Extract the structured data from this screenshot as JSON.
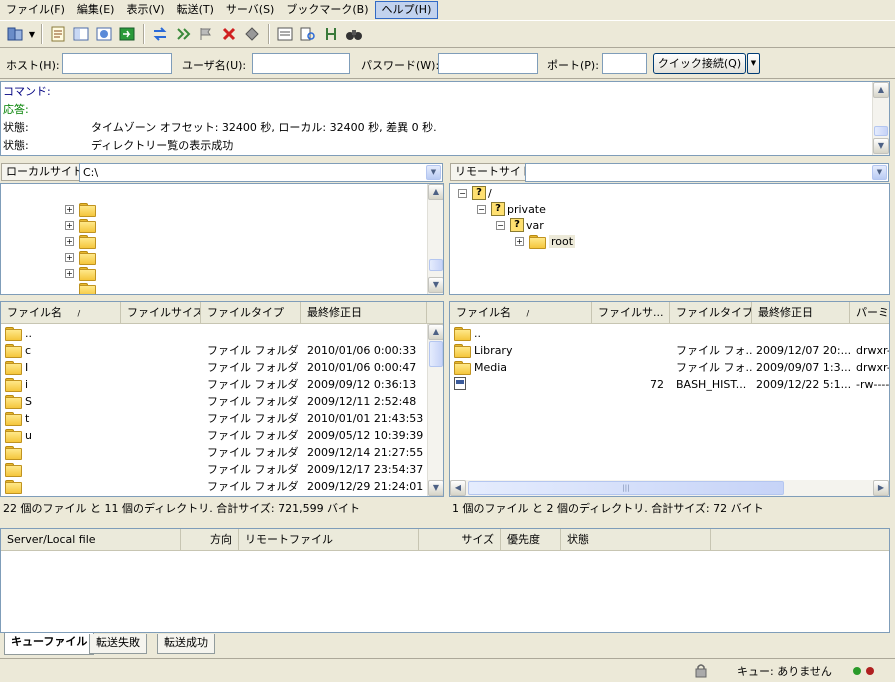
{
  "menu": [
    "ファイル(F)",
    "編集(E)",
    "表示(V)",
    "転送(T)",
    "サーバ(S)",
    "ブックマーク(B)",
    "ヘルプ(H)"
  ],
  "quickconnect": {
    "host_label": "ホスト(H):",
    "user_label": "ユーザ名(U):",
    "password_label": "パスワード(W):",
    "port_label": "ポート(P):",
    "host_value": "",
    "user_value": "",
    "password_value": "",
    "port_value": "",
    "connect_button": "クイック接続(Q)"
  },
  "log": [
    {
      "label": "コマンド:",
      "text": "",
      "color": "#000080"
    },
    {
      "label": "応答:",
      "text": "",
      "color": "#008000"
    },
    {
      "label": "状態:",
      "text": "タイムゾーン オフセット: 32400 秒, ローカル: 32400 秒, 差異 0 秒.",
      "color": "#000000"
    },
    {
      "label": "状態:",
      "text": "ディレクトリー覧の表示成功",
      "color": "#000000"
    }
  ],
  "local": {
    "site_label": "ローカルサイト:",
    "path": "C:\\",
    "columns": [
      "ファイル名",
      "ファイルサイズ",
      "ファイルタイプ",
      "最終修正日"
    ],
    "rows": [
      {
        "name": "..",
        "size": "",
        "type": "",
        "date": ""
      },
      {
        "name": "c",
        "size": "",
        "type": "ファイル フォルダ",
        "date": "2010/01/06 0:00:33"
      },
      {
        "name": "I",
        "size": "",
        "type": "ファイル フォルダ",
        "date": "2010/01/06 0:00:47"
      },
      {
        "name": "i",
        "size": "",
        "type": "ファイル フォルダ",
        "date": "2009/09/12 0:36:13"
      },
      {
        "name": "S",
        "size": "",
        "type": "ファイル フォルダ",
        "date": "2009/12/11 2:52:48"
      },
      {
        "name": "t",
        "size": "",
        "type": "ファイル フォルダ",
        "date": "2010/01/01 21:43:53"
      },
      {
        "name": "u",
        "size": "",
        "type": "ファイル フォルダ",
        "date": "2009/05/12 10:39:39"
      },
      {
        "name": "",
        "size": "",
        "type": "ファイル フォルダ",
        "date": "2009/12/14 21:27:55"
      },
      {
        "name": "",
        "size": "",
        "type": "ファイル フォルダ",
        "date": "2009/12/17 23:54:37"
      },
      {
        "name": "",
        "size": "",
        "type": "ファイル フォルダ",
        "date": "2009/12/29 21:24:01"
      }
    ],
    "status": "22 個のファイル と 11 個のディレクトリ. 合計サイズ: 721,599 バイト"
  },
  "remote": {
    "site_label": "リモートサイト:",
    "path": "",
    "tree": [
      {
        "label": "/",
        "depth": 0,
        "expander": "⊟",
        "icon": "question"
      },
      {
        "label": "private",
        "depth": 1,
        "expander": "⊟",
        "icon": "question"
      },
      {
        "label": "var",
        "depth": 2,
        "expander": "⊟",
        "icon": "question"
      },
      {
        "label": "root",
        "depth": 3,
        "expander": "⊞",
        "icon": "folder"
      }
    ],
    "columns": [
      "ファイル名",
      "ファイルサ...",
      "ファイルタイプ",
      "最終修正日",
      "パーミ..."
    ],
    "rows": [
      {
        "name": "..",
        "size": "",
        "type": "",
        "date": "",
        "perm": "",
        "icon": "folder"
      },
      {
        "name": "Library",
        "size": "",
        "type": "ファイル フォ...",
        "date": "2009/12/07 20:...",
        "perm": "drwxr-...",
        "icon": "folder"
      },
      {
        "name": "Media",
        "size": "",
        "type": "ファイル フォ...",
        "date": "2009/09/07 1:3...",
        "perm": "drwxr-...",
        "icon": "folder"
      },
      {
        "name": "",
        "size": "72",
        "type": "BASH_HIST...",
        "date": "2009/12/22 5:1...",
        "perm": "-rw-----...",
        "icon": "file"
      }
    ],
    "status": "1 個のファイル と 2 個のディレクトリ. 合計サイズ: 72 バイト"
  },
  "queue": {
    "columns": [
      "Server/Local file",
      "方向",
      "リモートファイル",
      "サイズ",
      "優先度",
      "状態"
    ]
  },
  "tabs": [
    "キューファイル",
    "転送失敗",
    "転送成功"
  ],
  "statusbar": {
    "queue_text": "キュー: ありません"
  },
  "colors": {
    "accent": "#316ac5",
    "window_bg": "#ece9d8",
    "led_green": "#2a9a2a",
    "led_red": "#b02020"
  }
}
